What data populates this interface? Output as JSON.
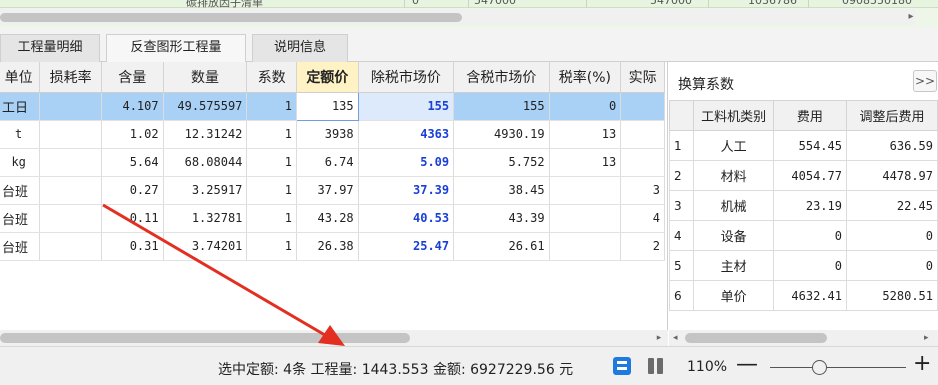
{
  "top_strip": {
    "fragments": [
      "碳排放因子清单",
      "0",
      "547000",
      "547000",
      "1036786",
      "0908550180"
    ]
  },
  "tabs": [
    {
      "label": "工程量明细",
      "active": false
    },
    {
      "label": "反查图形工程量",
      "active": true
    },
    {
      "label": "说明信息",
      "active": false
    }
  ],
  "grid": {
    "columns": [
      "单位",
      "损耗率",
      "含量",
      "数量",
      "系数",
      "定额价",
      "除税市场价",
      "含税市场价",
      "税率(%)",
      "实际"
    ],
    "highlight_column": "定额价",
    "rows": [
      {
        "unit": "工日",
        "loss": "",
        "content": "4.107",
        "qty": "49.575597",
        "coef": "1",
        "base": "135",
        "excl": "155",
        "incl": "155",
        "tax": "0",
        "actual": ""
      },
      {
        "unit": "t",
        "loss": "",
        "content": "1.02",
        "qty": "12.31242",
        "coef": "1",
        "base": "3938",
        "excl": "4363",
        "incl": "4930.19",
        "tax": "13",
        "actual": ""
      },
      {
        "unit": "kg",
        "loss": "",
        "content": "5.64",
        "qty": "68.08044",
        "coef": "1",
        "base": "6.74",
        "excl": "5.09",
        "incl": "5.752",
        "tax": "13",
        "actual": ""
      },
      {
        "unit": "台班",
        "loss": "",
        "content": "0.27",
        "qty": "3.25917",
        "coef": "1",
        "base": "37.97",
        "excl": "37.39",
        "incl": "38.45",
        "tax": "",
        "actual": "3"
      },
      {
        "unit": "台班",
        "loss": "",
        "content": "0.11",
        "qty": "1.32781",
        "coef": "1",
        "base": "43.28",
        "excl": "40.53",
        "incl": "43.39",
        "tax": "",
        "actual": "4"
      },
      {
        "unit": "台班",
        "loss": "",
        "content": "0.31",
        "qty": "3.74201",
        "coef": "1",
        "base": "26.38",
        "excl": "25.47",
        "incl": "26.61",
        "tax": "",
        "actual": "2"
      }
    ]
  },
  "coef_panel": {
    "title": "换算系数",
    "toggle": ">>",
    "columns": [
      "",
      "工料机类别",
      "费用",
      "调整后费用"
    ],
    "rows": [
      {
        "idx": "1",
        "cat": "人工",
        "fee": "554.45",
        "adj": "636.59"
      },
      {
        "idx": "2",
        "cat": "材料",
        "fee": "4054.77",
        "adj": "4478.97"
      },
      {
        "idx": "3",
        "cat": "机械",
        "fee": "23.19",
        "adj": "22.45"
      },
      {
        "idx": "4",
        "cat": "设备",
        "fee": "0",
        "adj": "0"
      },
      {
        "idx": "5",
        "cat": "主材",
        "fee": "0",
        "adj": "0"
      },
      {
        "idx": "6",
        "cat": "单价",
        "fee": "4632.41",
        "adj": "5280.51"
      }
    ]
  },
  "status": {
    "summary": "选中定额: 4条 工程量: 1443.553 金额: 6927229.56 元",
    "zoom": "110%",
    "zoom_minus": "—",
    "zoom_plus": "+"
  },
  "colors": {
    "selected_row": "#a9d0f5",
    "price_blue": "#1a3fd6",
    "arrow": "#e32f22",
    "view_active": "#1f7ae0"
  }
}
